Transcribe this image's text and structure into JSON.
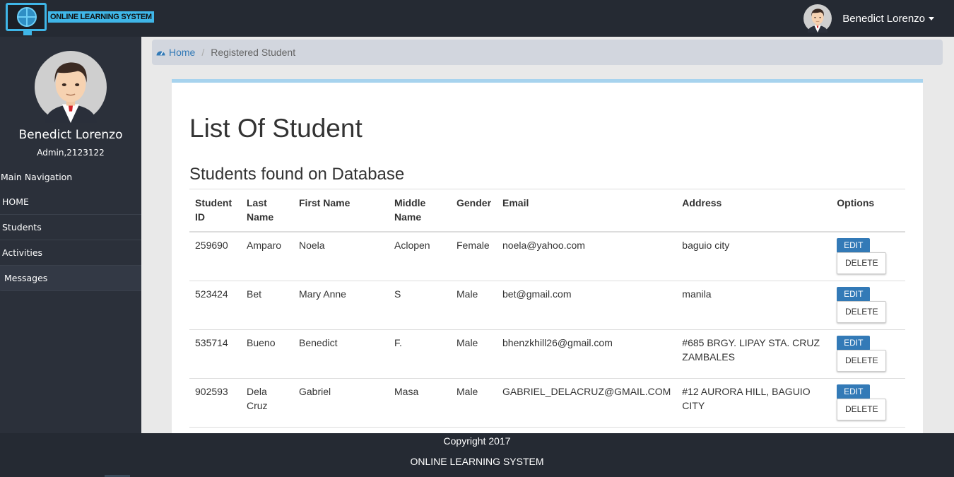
{
  "app": {
    "logo_text": "ONLINE LEARNING SYSTEM"
  },
  "header": {
    "user_name": "Benedict Lorenzo"
  },
  "sidebar": {
    "user_name": "Benedict Lorenzo",
    "user_role": "Admin,2123122",
    "nav_header": "Main Navigation",
    "items": [
      {
        "label": "HOME"
      },
      {
        "label": "Students"
      },
      {
        "label": "Activities"
      },
      {
        "label": "Messages"
      }
    ]
  },
  "breadcrumb": {
    "home": "Home",
    "current": "Registered Student"
  },
  "main": {
    "title": "List Of Student",
    "subtitle": "Students found on Database",
    "columns": [
      "Student ID",
      "Last Name",
      "First Name",
      "Middle Name",
      "Gender",
      "Email",
      "Address",
      "Options"
    ],
    "edit_label": "EDIT",
    "delete_label": "DELETE",
    "rows": [
      {
        "id": "259690",
        "last": "Amparo",
        "first": "Noela",
        "middle": "Aclopen",
        "gender": "Female",
        "email": "noela@yahoo.com",
        "address": "baguio city"
      },
      {
        "id": "523424",
        "last": "Bet",
        "first": "Mary Anne",
        "middle": "S",
        "gender": "Male",
        "email": "bet@gmail.com",
        "address": "manila"
      },
      {
        "id": "535714",
        "last": "Bueno",
        "first": "Benedict",
        "middle": "F.",
        "gender": "Male",
        "email": "bhenzkhill26@gmail.com",
        "address": "#685 BRGY. LIPAY STA. CRUZ ZAMBALES"
      },
      {
        "id": "902593",
        "last": "Dela Cruz",
        "first": "Gabriel",
        "middle": "Masa",
        "gender": "Male",
        "email": "GABRIEL_DELACRUZ@GMAIL.COM",
        "address": "#12 AURORA HILL, BAGUIO CITY"
      }
    ]
  },
  "footer": {
    "copyright": "Copyright 2017",
    "system_name": "ONLINE LEARNING SYSTEM"
  },
  "colors": {
    "topbar": "#252a33",
    "sidebar": "#2b303a",
    "accent": "#337ab7",
    "logo": "#3fb6e8",
    "box_border": "#a7d3ee"
  },
  "icons": {
    "logo": "globe-monitor-icon",
    "breadcrumb_home": "dashboard-icon",
    "user_menu": "caret-down-icon"
  }
}
